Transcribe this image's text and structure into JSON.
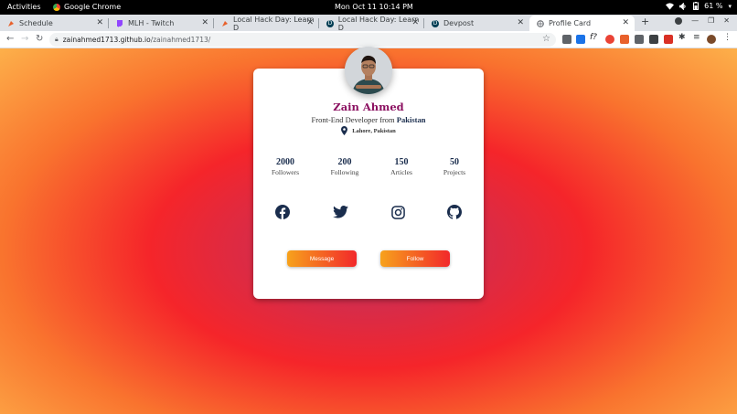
{
  "topbar": {
    "activities": "Activities",
    "app_name": "Google Chrome",
    "clock": "Mon Oct 11  10:14 PM",
    "battery": "61 %"
  },
  "tabs": [
    {
      "title": "Schedule",
      "icon": "schedule-favicon",
      "color": "#e8612c"
    },
    {
      "title": "MLH - Twitch",
      "icon": "twitch-favicon",
      "color": "#9146ff"
    },
    {
      "title": "Local Hack Day: Learn D",
      "icon": "mlh-favicon",
      "color": "#e8612c"
    },
    {
      "title": "Local Hack Day: Learn D",
      "icon": "devpost-favicon",
      "color": "#003e54"
    },
    {
      "title": "Devpost",
      "icon": "devpost-favicon",
      "color": "#003e54"
    },
    {
      "title": "Profile Card",
      "icon": "globe-favicon",
      "color": "#5f6368",
      "active": true
    }
  ],
  "address_bar": {
    "host": "zainahmed1713.github.io",
    "path": "/zainahmed1713/"
  },
  "profile": {
    "name": "Zain Ahmed",
    "role_prefix": "Front-End Developer from ",
    "country": "Pakistan",
    "location": "Lahore, Pakistan"
  },
  "stats": [
    {
      "value": "2000",
      "label": "Followers"
    },
    {
      "value": "200",
      "label": "Following"
    },
    {
      "value": "150",
      "label": "Articles"
    },
    {
      "value": "50",
      "label": "Projects"
    }
  ],
  "social_icons": [
    "facebook-icon",
    "twitter-icon",
    "instagram-icon",
    "github-icon"
  ],
  "buttons": {
    "message": "Message",
    "follow": "Follow"
  },
  "colors": {
    "name": "#8b1060",
    "accent": "#1a2d4d",
    "button_start": "#f7a21c",
    "button_end": "#f2282a"
  }
}
